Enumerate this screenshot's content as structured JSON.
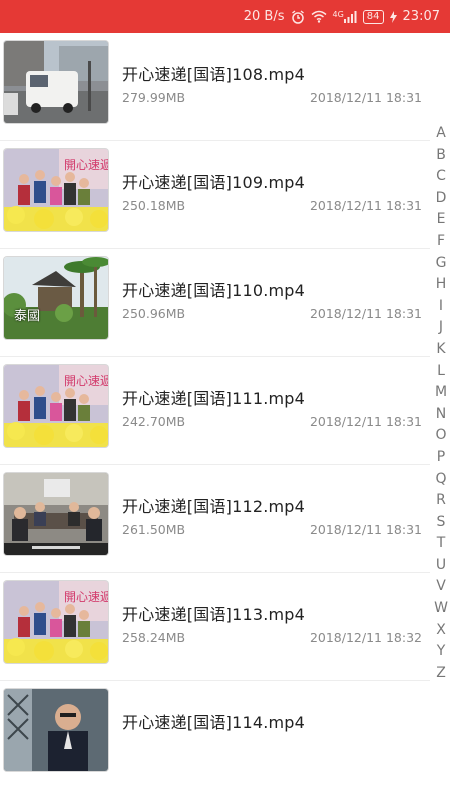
{
  "status_bar": {
    "speed": "20 B/s",
    "network": "4G",
    "battery": "84",
    "time": "23:07",
    "icons": [
      "alarm-icon",
      "wifi-icon",
      "signal-icon",
      "battery-icon",
      "charging-icon"
    ]
  },
  "videos": [
    {
      "title": "开心速递[国语]108.mp4",
      "size": "279.99MB",
      "date": "2018/12/11 18:31",
      "thumbnail": "street-van-thumbnail"
    },
    {
      "title": "开心速递[国语]109.mp4",
      "size": "250.18MB",
      "date": "2018/12/11 18:31",
      "thumbnail": "group-cast-thumbnail"
    },
    {
      "title": "开心速递[国语]110.mp4",
      "size": "250.96MB",
      "date": "2018/12/11 18:31",
      "thumbnail": "palm-trees-thumbnail",
      "caption": "泰國"
    },
    {
      "title": "开心速递[国语]111.mp4",
      "size": "242.70MB",
      "date": "2018/12/11 18:31",
      "thumbnail": "group-cast-thumbnail"
    },
    {
      "title": "开心速递[国语]112.mp4",
      "size": "261.50MB",
      "date": "2018/12/11 18:31",
      "thumbnail": "office-meeting-thumbnail"
    },
    {
      "title": "开心速递[国语]113.mp4",
      "size": "258.24MB",
      "date": "2018/12/11 18:32",
      "thumbnail": "group-cast-thumbnail"
    },
    {
      "title": "开心速递[国语]114.mp4",
      "size": "",
      "date": "",
      "thumbnail": "man-portrait-thumbnail"
    }
  ],
  "alphabet_index": [
    "A",
    "B",
    "C",
    "D",
    "E",
    "F",
    "G",
    "H",
    "I",
    "J",
    "K",
    "L",
    "M",
    "N",
    "O",
    "P",
    "Q",
    "R",
    "S",
    "T",
    "U",
    "V",
    "W",
    "X",
    "Y",
    "Z"
  ]
}
